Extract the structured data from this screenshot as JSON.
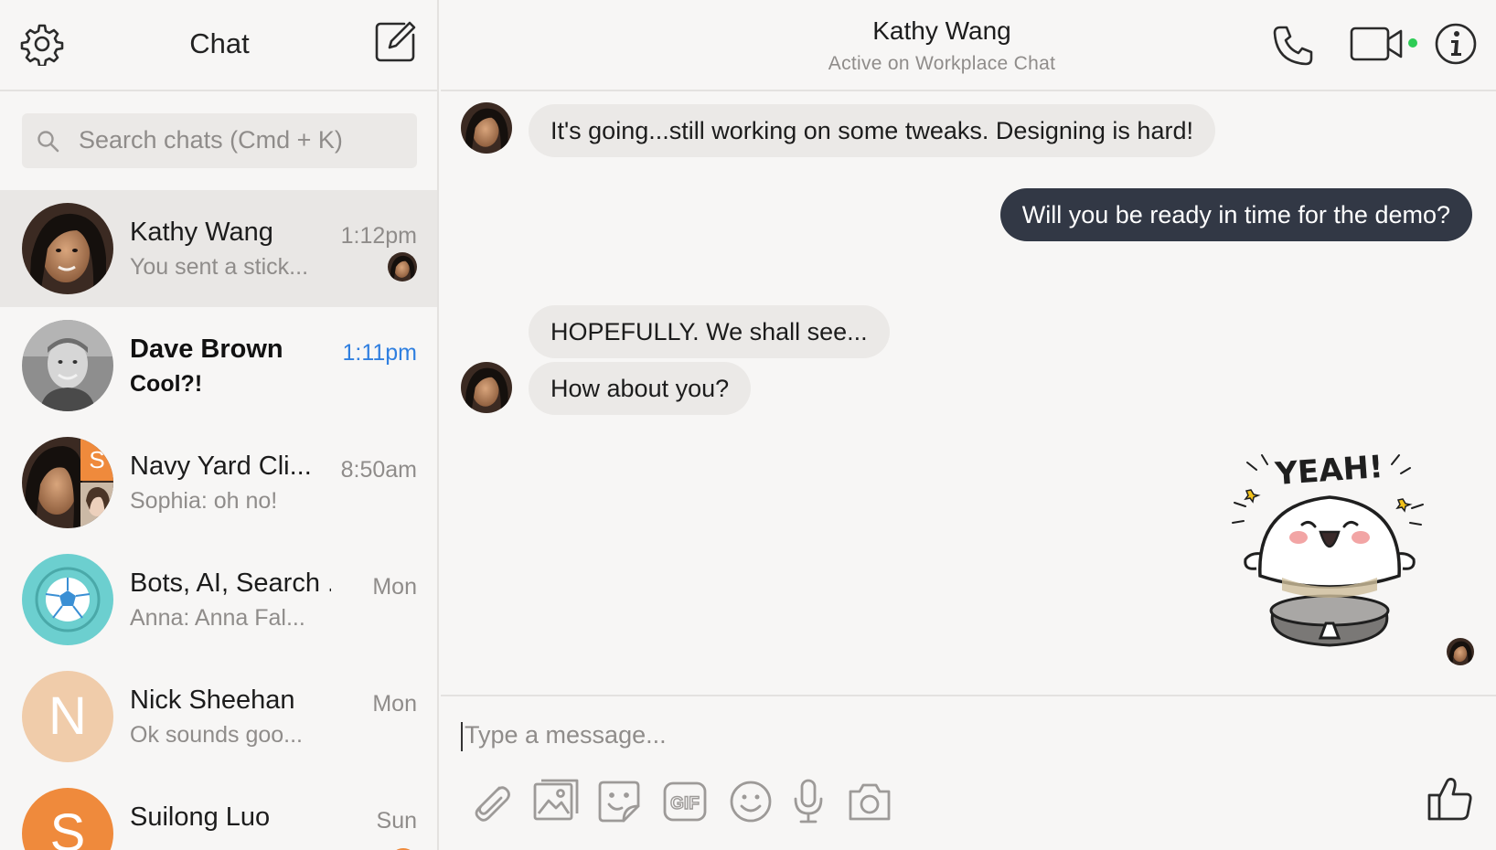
{
  "sidebar": {
    "title": "Chat",
    "search": {
      "placeholder": "Search chats (Cmd + K)"
    },
    "chats": [
      {
        "name": "Kathy Wang",
        "preview": "You sent a stick...",
        "time": "1:12pm",
        "active": true,
        "unread": false
      },
      {
        "name": "Dave Brown",
        "preview": "Cool?!",
        "time": "1:11pm",
        "active": false,
        "unread": true
      },
      {
        "name": "Navy Yard Cli...",
        "preview": "Sophia: oh no!",
        "time": "8:50am",
        "badge_letter": "S"
      },
      {
        "name": "Bots, AI, Search ...",
        "preview": "Anna: Anna Fal...",
        "time": "Mon"
      },
      {
        "name": "Nick Sheehan",
        "preview": "Ok sounds goo...",
        "time": "Mon",
        "avatar_letter": "N"
      },
      {
        "name": "Suilong Luo",
        "preview": "",
        "time": "Sun",
        "avatar_letter": "S"
      }
    ]
  },
  "conversation": {
    "name": "Kathy Wang",
    "status": "Active on Workplace Chat",
    "messages": [
      {
        "direction": "in",
        "text": "It's going...still working on some tweaks. Designing is hard!"
      },
      {
        "direction": "out",
        "text": "Will you be ready in time for the demo?"
      },
      {
        "direction": "in",
        "text": "HOPEFULLY. We shall see..."
      },
      {
        "direction": "in",
        "text": "How about you?"
      }
    ],
    "sticker": {
      "text": "YEAH!"
    },
    "composer": {
      "placeholder": "Type a message..."
    },
    "tools": [
      "paperclip-icon",
      "image-icon",
      "sticker-icon",
      "gif-icon",
      "emoji-icon",
      "microphone-icon",
      "camera-icon"
    ],
    "tool_gif_label": "GIF"
  },
  "colors": {
    "background": "#f7f6f5",
    "bubble_in": "#ebe9e7",
    "bubble_out": "#323845",
    "unread_time": "#2f7fe0",
    "online": "#2ecc55",
    "orange": "#ef8a3c",
    "teal": "#6ccfcf",
    "peach": "#f0ccaa"
  }
}
